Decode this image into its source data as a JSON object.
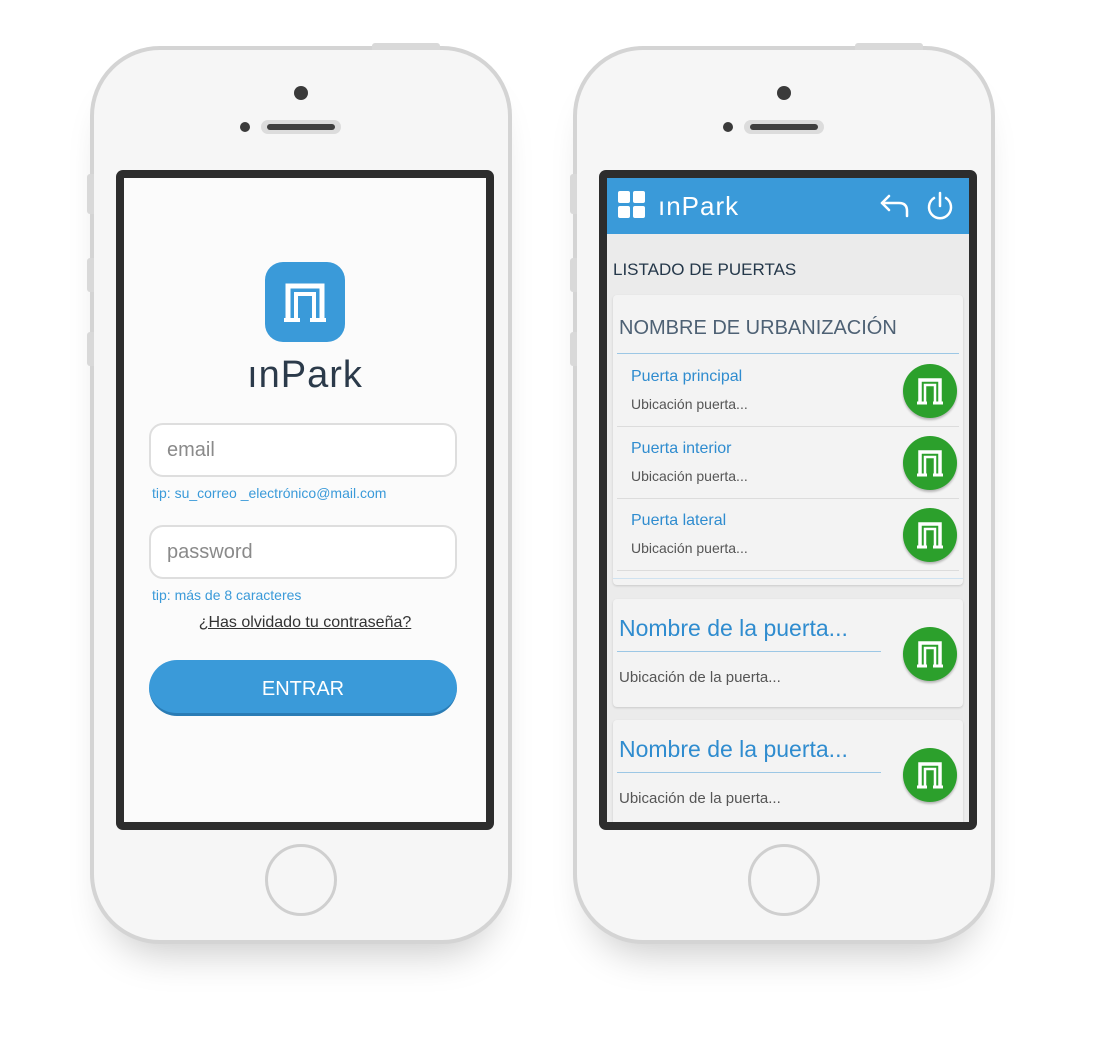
{
  "login": {
    "logo_text": "ınPark",
    "email_placeholder": "email",
    "email_tip": "tip: su_correo _electrónico@mail.com",
    "password_placeholder": "password",
    "password_tip": "tip: más de 8 caracteres",
    "forgot_link": "¿Has olvidado tu contraseña?",
    "enter_button": "ENTRAR"
  },
  "list": {
    "header_logo": "ınPark",
    "section_title": "LISTADO DE PUERTAS",
    "group": {
      "title": "NOMBRE DE URBANIZACIÓN",
      "doors": [
        {
          "name": "Puerta principal",
          "location": "Ubicación puerta..."
        },
        {
          "name": "Puerta interior",
          "location": "Ubicación puerta..."
        },
        {
          "name": "Puerta lateral",
          "location": "Ubicación puerta..."
        }
      ]
    },
    "cards": [
      {
        "name": "Nombre de la puerta...",
        "location": "Ubicación de la puerta..."
      },
      {
        "name": "Nombre de la puerta...",
        "location": "Ubicación de la puerta..."
      }
    ]
  },
  "colors": {
    "brand_blue": "#3a9ad9",
    "open_green": "#2ca02c",
    "dark_text": "#25384a"
  },
  "icons": [
    "gate-icon",
    "grid-menu-icon",
    "back-arrow-icon",
    "power-icon"
  ]
}
